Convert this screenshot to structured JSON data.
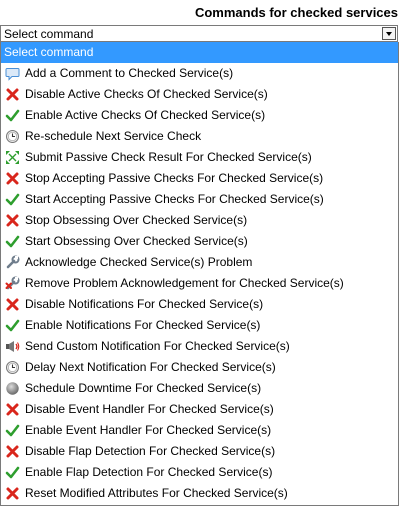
{
  "header": {
    "title": "Commands for checked services"
  },
  "select": {
    "value": "Select command"
  },
  "options": [
    {
      "label": "Select command",
      "icon": "",
      "selected": true
    },
    {
      "label": "Add a Comment to Checked Service(s)",
      "icon": "comment-icon"
    },
    {
      "label": "Disable Active Checks Of Checked Service(s)",
      "icon": "disable-icon"
    },
    {
      "label": "Enable Active Checks Of Checked Service(s)",
      "icon": "enable-icon"
    },
    {
      "label": "Re-schedule Next Service Check",
      "icon": "clock-icon"
    },
    {
      "label": "Submit Passive Check Result For Checked Service(s)",
      "icon": "passive-icon"
    },
    {
      "label": "Stop Accepting Passive Checks For Checked Service(s)",
      "icon": "disable-icon"
    },
    {
      "label": "Start Accepting Passive Checks For Checked Service(s)",
      "icon": "enable-icon"
    },
    {
      "label": "Stop Obsessing Over Checked Service(s)",
      "icon": "disable-icon"
    },
    {
      "label": "Start Obsessing Over Checked Service(s)",
      "icon": "enable-icon"
    },
    {
      "label": "Acknowledge Checked Service(s) Problem",
      "icon": "wrench-icon"
    },
    {
      "label": "Remove Problem Acknowledgement for Checked Service(s)",
      "icon": "wrench-remove-icon"
    },
    {
      "label": "Disable Notifications For Checked Service(s)",
      "icon": "disable-icon"
    },
    {
      "label": "Enable Notifications For Checked Service(s)",
      "icon": "enable-icon"
    },
    {
      "label": "Send Custom Notification For Checked Service(s)",
      "icon": "megaphone-icon"
    },
    {
      "label": "Delay Next Notification For Checked Service(s)",
      "icon": "clock-icon"
    },
    {
      "label": "Schedule Downtime For Checked Service(s)",
      "icon": "downtime-icon"
    },
    {
      "label": "Disable Event Handler For Checked Service(s)",
      "icon": "disable-icon"
    },
    {
      "label": "Enable Event Handler For Checked Service(s)",
      "icon": "enable-icon"
    },
    {
      "label": "Disable Flap Detection For Checked Service(s)",
      "icon": "disable-icon"
    },
    {
      "label": "Enable Flap Detection For Checked Service(s)",
      "icon": "enable-icon"
    },
    {
      "label": "Reset Modified Attributes For Checked Service(s)",
      "icon": "disable-icon"
    }
  ],
  "colors": {
    "selected_bg": "#3399ff",
    "disable_red": "#d9261c",
    "enable_green": "#2e9e2e",
    "comment_blue": "#4a8fd6"
  }
}
